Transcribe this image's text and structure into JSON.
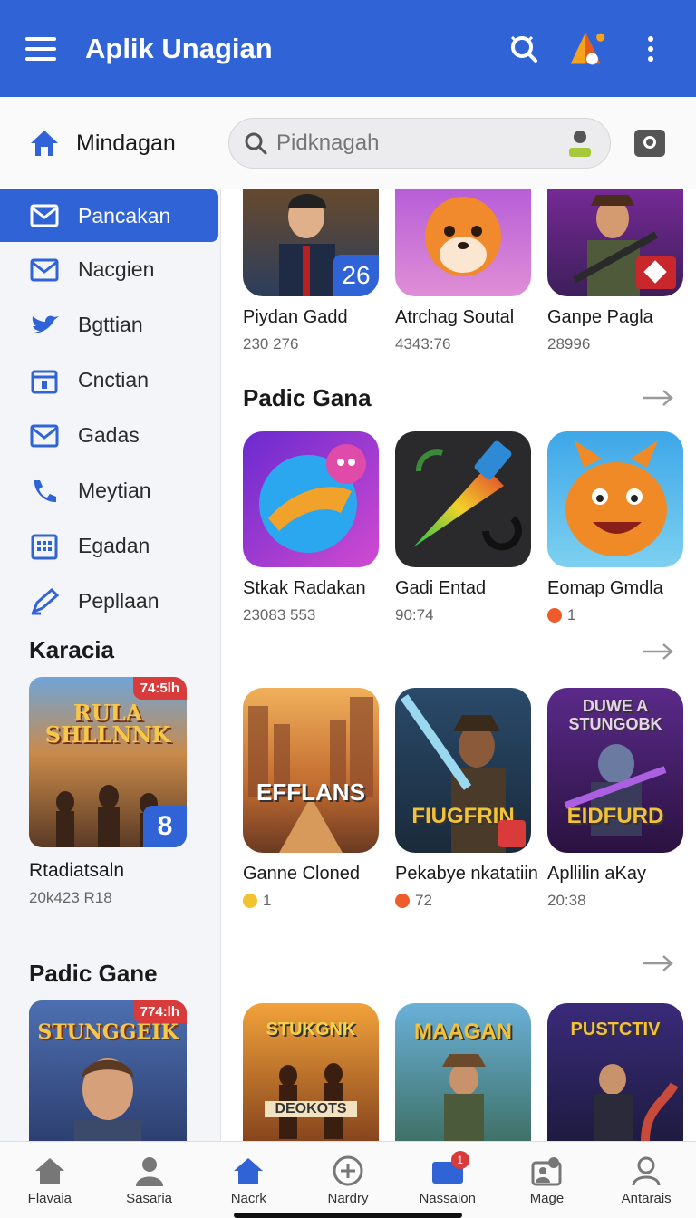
{
  "app": {
    "title": "Aplik Unagian"
  },
  "search_row": {
    "home_label": "Mindagan",
    "search_placeholder": "Pidknagah"
  },
  "sidebar": {
    "items": [
      {
        "label": "Pancakan",
        "icon": "mail-icon",
        "active": true
      },
      {
        "label": "Nacgien",
        "icon": "mail-icon"
      },
      {
        "label": "Bgttian",
        "icon": "bird-icon"
      },
      {
        "label": "Cnctian",
        "icon": "calendar-icon"
      },
      {
        "label": "Gadas",
        "icon": "mail-icon"
      },
      {
        "label": "Meytian",
        "icon": "phone-icon"
      },
      {
        "label": "Egadan",
        "icon": "grid-calendar-icon"
      },
      {
        "label": "Pepllaan",
        "icon": "pen-icon"
      }
    ],
    "section1": {
      "heading": "Karacia",
      "card_time": "74:5lh",
      "card_art_text": "RULA SHLLNNK",
      "card_badge": "8",
      "title": "Rtadiatsaln",
      "subtitle": "20k423 R18"
    },
    "section2": {
      "heading": "Padic Gane",
      "card_time": "774:lh",
      "card_art_text": "STUNGGEIK"
    }
  },
  "main": {
    "row1": [
      {
        "name": "Piydan Gadd",
        "meta": "230 276",
        "badge": "26"
      },
      {
        "name": "Atrchag Soutal",
        "meta": "4343:76"
      },
      {
        "name": "Ganpe Pagla",
        "meta": "28996"
      }
    ],
    "section1_title": "Padic Gana",
    "row2": [
      {
        "name": "Stkak Radakan",
        "meta": "23083 553"
      },
      {
        "name": "Gadi Entad",
        "meta": "90:74"
      },
      {
        "name": "Eomap Gmdla",
        "meta": "1"
      }
    ],
    "row3": [
      {
        "name": "Ganne Cloned",
        "meta": "1",
        "art": "EFFLANS"
      },
      {
        "name": "Pekabye nkatatiin",
        "meta": "72",
        "art": "FIUGFRIN"
      },
      {
        "name": "Apllilin aKay",
        "meta": "20:38",
        "art": "EIDFURD",
        "art_top": "DUWE A STUNGOBK"
      }
    ],
    "row4": [
      {
        "art": "DEOKOTS",
        "art_top": "STUKGNK"
      },
      {
        "art": "MAAGAN"
      },
      {
        "art": "PUSTCTIV"
      }
    ]
  },
  "bottom_nav": [
    {
      "label": "Flavaia",
      "icon": "home-icon"
    },
    {
      "label": "Sasaria",
      "icon": "person-icon"
    },
    {
      "label": "Nacrk",
      "icon": "home-active-icon"
    },
    {
      "label": "Nardry",
      "icon": "plus-circle-icon"
    },
    {
      "label": "Nassaion",
      "icon": "inbox-icon",
      "badge": "1"
    },
    {
      "label": "Mage",
      "icon": "profile-card-icon"
    },
    {
      "label": "Antarais",
      "icon": "user-outline-icon"
    }
  ],
  "colors": {
    "primary": "#2f63d6",
    "badge_red": "#d93a3a",
    "coin": "#f2c230"
  }
}
